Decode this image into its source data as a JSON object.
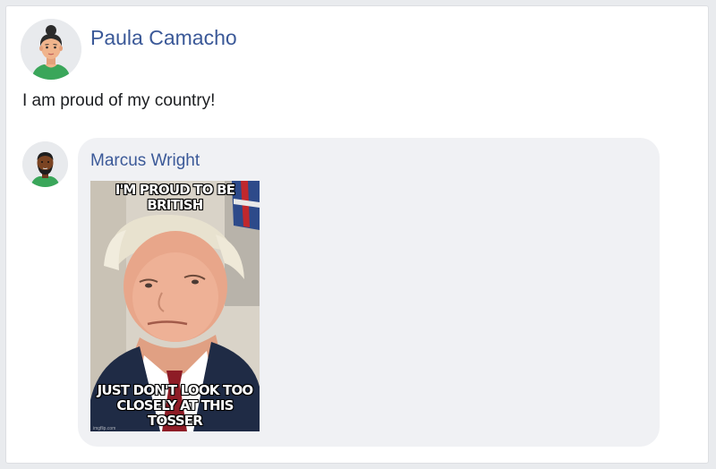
{
  "post": {
    "author": {
      "name": "Paula Camacho",
      "avatar_icon": "woman-avatar-icon"
    },
    "text": "I am proud of my country!"
  },
  "comment": {
    "author": {
      "name": "Marcus Wright",
      "avatar_icon": "man-avatar-icon"
    },
    "meme": {
      "top_caption": "I'M PROUD TO BE BRITISH",
      "bottom_caption": "JUST DON'T LOOK TOO CLOSELY AT THIS TOSSER",
      "watermark": "imgflip.com"
    }
  },
  "colors": {
    "name_link": "#3b5998",
    "bubble": "#f0f1f4",
    "page_background": "#e9ebee"
  }
}
